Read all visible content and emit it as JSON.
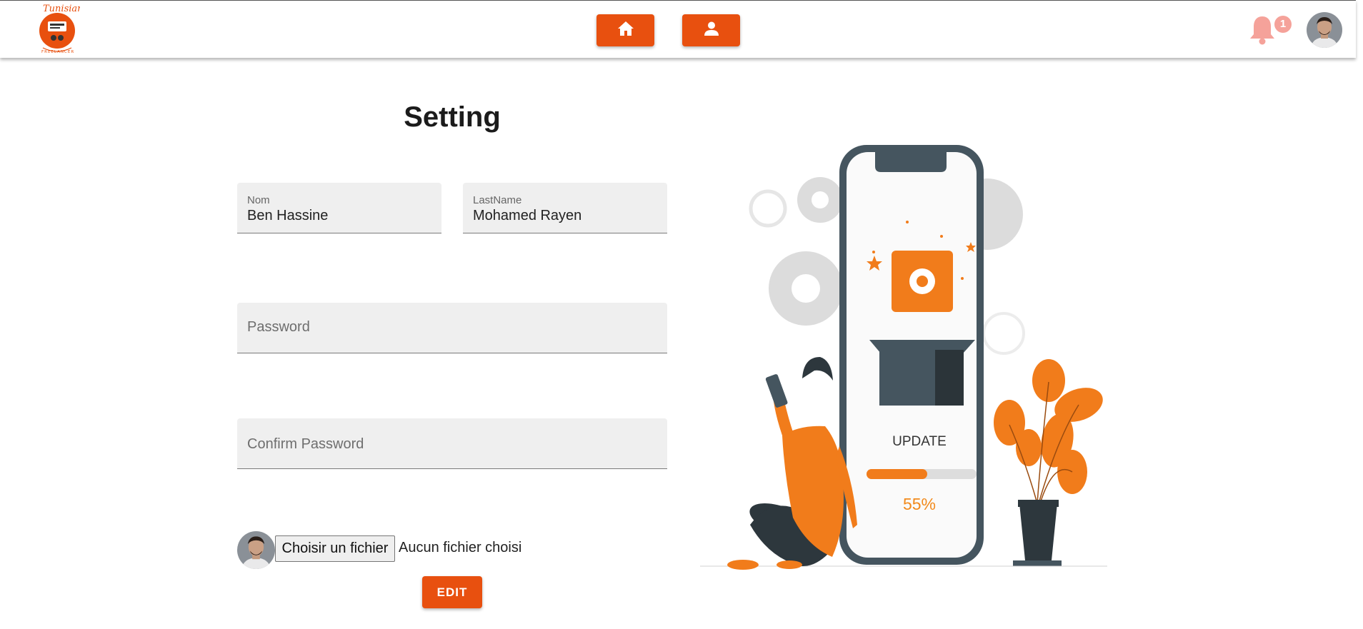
{
  "header": {
    "logo_icon": "tunisian-freelancer-logo",
    "home_icon": "home-icon",
    "profile_icon": "person-icon",
    "notifications": {
      "icon": "bell-icon",
      "count": "1",
      "color": "#f5a29a"
    },
    "accent": "#e8500f"
  },
  "form": {
    "title": "Setting",
    "nom": {
      "label": "Nom",
      "value": "Ben Hassine"
    },
    "lastname": {
      "label": "LastName",
      "value": "Mohamed Rayen"
    },
    "password": {
      "placeholder": "Password"
    },
    "confirm_password": {
      "placeholder": "Confirm Password"
    },
    "file": {
      "button_label": "Choisir un fichier",
      "status": "Aucun fichier choisi"
    },
    "edit_label": "EDIT"
  },
  "illustration": {
    "update_label": "UPDATE",
    "progress_label": "55%",
    "progress": 0.55,
    "accent": "#f28a1c"
  }
}
